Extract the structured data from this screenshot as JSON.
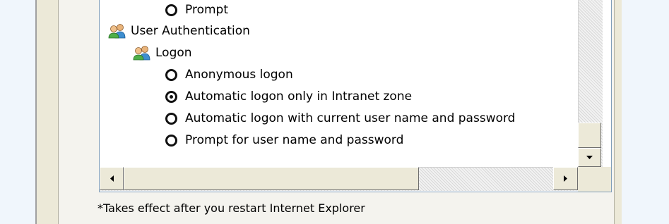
{
  "tree": {
    "item_prompt": "Prompt",
    "user_authentication": "User Authentication",
    "logon": "Logon",
    "options": [
      {
        "label": "Anonymous logon",
        "checked": false
      },
      {
        "label": "Automatic logon only in Intranet zone",
        "checked": true
      },
      {
        "label": "Automatic logon with current user name and password",
        "checked": false
      },
      {
        "label": "Prompt for user name and password",
        "checked": false
      }
    ]
  },
  "footnote": "*Takes effect after you restart Internet Explorer",
  "icons": {
    "users": "users-icon",
    "scroll_down": "arrow-down-icon",
    "scroll_left": "arrow-left-icon",
    "scroll_right": "arrow-right-icon"
  }
}
